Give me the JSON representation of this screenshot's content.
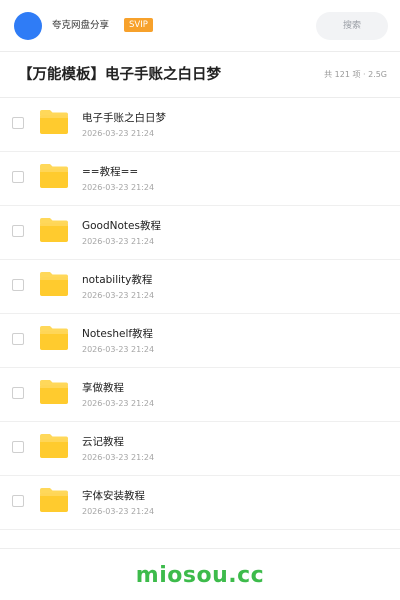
{
  "header": {
    "user_name": "夸克网盘分享",
    "vip_badge": "SVIP",
    "search_placeholder": "搜索",
    "avatar_color": "#2f7cf6"
  },
  "folder": {
    "title": "【万能模板】电子手账之白日梦",
    "meta": "共 121 项 · 2.5G"
  },
  "items": [
    {
      "name": "电子手账之白日梦",
      "date": "2026-03-23 21:24",
      "icon": "folder-icon"
    },
    {
      "name": "==教程==",
      "date": "2026-03-23 21:24",
      "icon": "folder-icon"
    },
    {
      "name": "GoodNotes教程",
      "date": "2026-03-23 21:24",
      "icon": "folder-icon"
    },
    {
      "name": "notability教程",
      "date": "2026-03-23 21:24",
      "icon": "folder-icon"
    },
    {
      "name": "Noteshelf教程",
      "date": "2026-03-23 21:24",
      "icon": "folder-icon"
    },
    {
      "name": "享做教程",
      "date": "2026-03-23 21:24",
      "icon": "folder-icon"
    },
    {
      "name": "云记教程",
      "date": "2026-03-23 21:24",
      "icon": "folder-icon"
    },
    {
      "name": "字体安装教程",
      "date": "2026-03-23 21:24",
      "icon": "folder-icon"
    }
  ],
  "watermark": "miosou.cc",
  "colors": {
    "folder_body": "#ffcb2e",
    "folder_tab": "#ffd85a",
    "vip": "#f7a12b",
    "watermark": "#3dbb4b"
  }
}
